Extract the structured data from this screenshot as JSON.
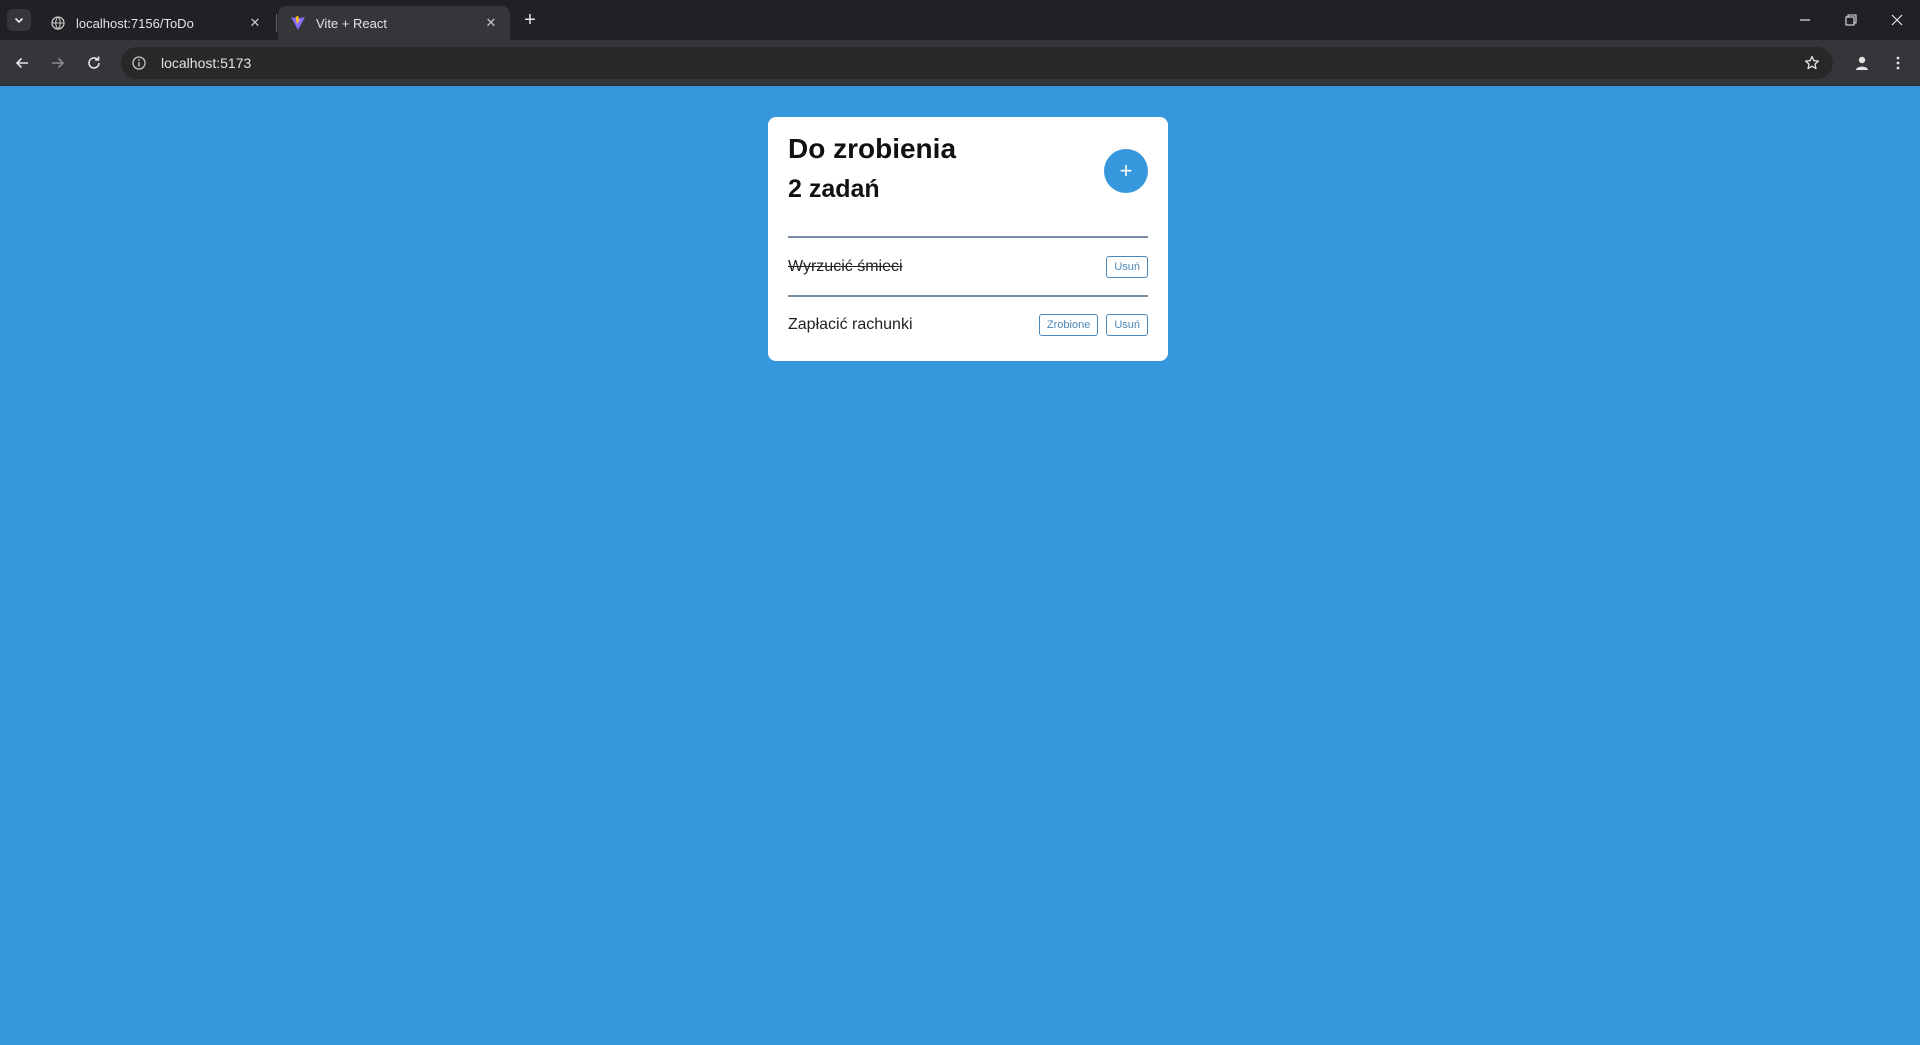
{
  "browser": {
    "tabs": [
      {
        "title": "localhost:7156/ToDo",
        "active": false,
        "icon": "globe-icon"
      },
      {
        "title": "Vite + React",
        "active": true,
        "icon": "vite-logo-icon"
      }
    ],
    "url": "localhost:5173"
  },
  "app": {
    "title": "Do zrobienia",
    "count_label": "2 zadań",
    "add_button_label": "+",
    "tasks": [
      {
        "text": "Wyrzucić śmieci",
        "done": true,
        "remove_label": "Usuń"
      },
      {
        "text": "Zapłacić rachunki",
        "done": false,
        "done_label": "Zrobione",
        "remove_label": "Usuń"
      }
    ]
  },
  "colors": {
    "page_background": "#3797dc",
    "accent": "#3797dc",
    "button_border": "#4d88b8",
    "divider": "#7b8ea5"
  }
}
